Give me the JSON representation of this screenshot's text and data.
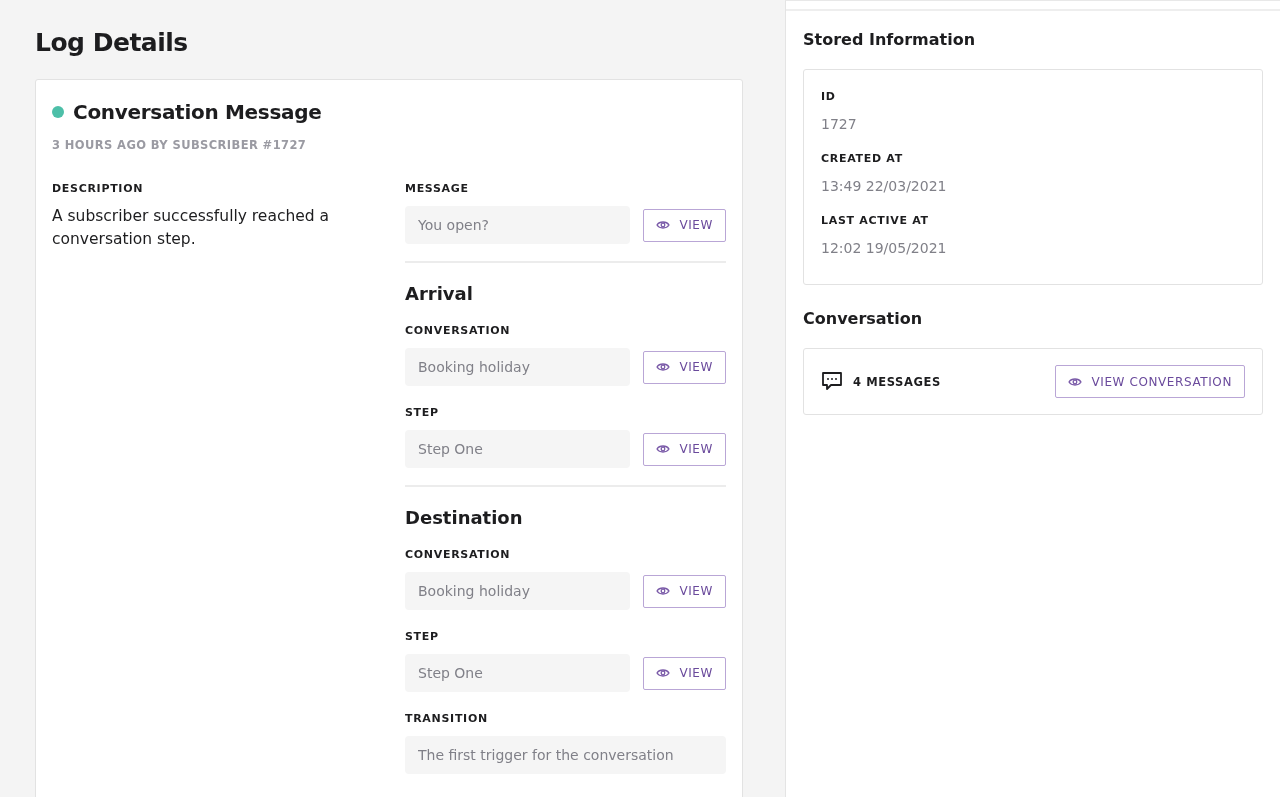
{
  "page": {
    "title": "Log Details"
  },
  "log": {
    "title": "Conversation Message",
    "color": "#4dbfa8",
    "meta": "3 HOURS AGO BY SUBSCRIBER #1727",
    "description_label": "DESCRIPTION",
    "description": "A subscriber successfully reached a conversation step.",
    "groups": [
      {
        "fields": [
          {
            "label": "MESSAGE",
            "value": "You open?",
            "button": "VIEW"
          }
        ]
      },
      {
        "heading": "Arrival",
        "fields": [
          {
            "label": "CONVERSATION",
            "value": "Booking holiday",
            "button": "VIEW"
          },
          {
            "label": "STEP",
            "value": "Step One",
            "button": "VIEW"
          }
        ]
      },
      {
        "heading": "Destination",
        "fields": [
          {
            "label": "CONVERSATION",
            "value": "Booking holiday",
            "button": "VIEW"
          },
          {
            "label": "STEP",
            "value": "Step One",
            "button": "VIEW"
          },
          {
            "label": "TRANSITION",
            "value": "The first trigger for the conversation"
          }
        ]
      }
    ]
  },
  "stored": {
    "title": "Stored Information",
    "items": [
      {
        "label": "ID",
        "value": "1727"
      },
      {
        "label": "CREATED AT",
        "value": "13:49 22/03/2021"
      },
      {
        "label": "LAST ACTIVE AT",
        "value": "12:02 19/05/2021"
      }
    ]
  },
  "conversation": {
    "title": "Conversation",
    "count": "4 MESSAGES",
    "button": "VIEW CONVERSATION"
  }
}
